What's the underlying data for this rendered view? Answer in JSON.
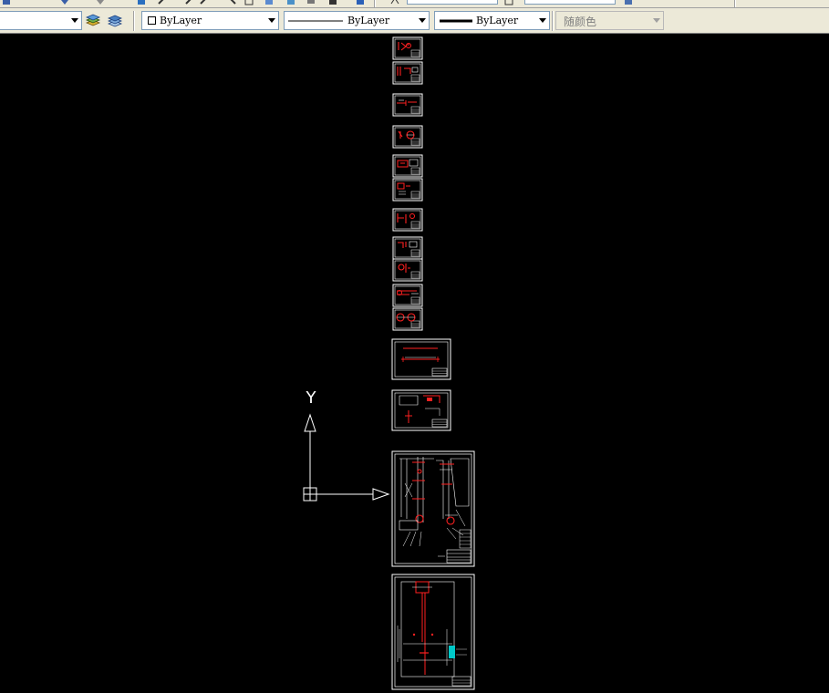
{
  "properties_toolbar": {
    "layer_control": {
      "value": ""
    },
    "color_control": {
      "value": "ByLayer"
    },
    "linetype_control": {
      "value": "ByLayer"
    },
    "lineweight_control": {
      "value": "ByLayer"
    },
    "plotstyle_control": {
      "value": "随颜色"
    }
  },
  "ucs_icon": {
    "y_label": "Y"
  },
  "colors": {
    "canvas": "#000000",
    "toolbar": "#ece9d8",
    "geometry": "#ffffff",
    "accent": "#ff2020",
    "highlight": "#00c8c8"
  },
  "icons": [
    "layer-states-icon",
    "layer-previous-icon",
    "dropdown-arrow-icon",
    "ucs-icon"
  ]
}
